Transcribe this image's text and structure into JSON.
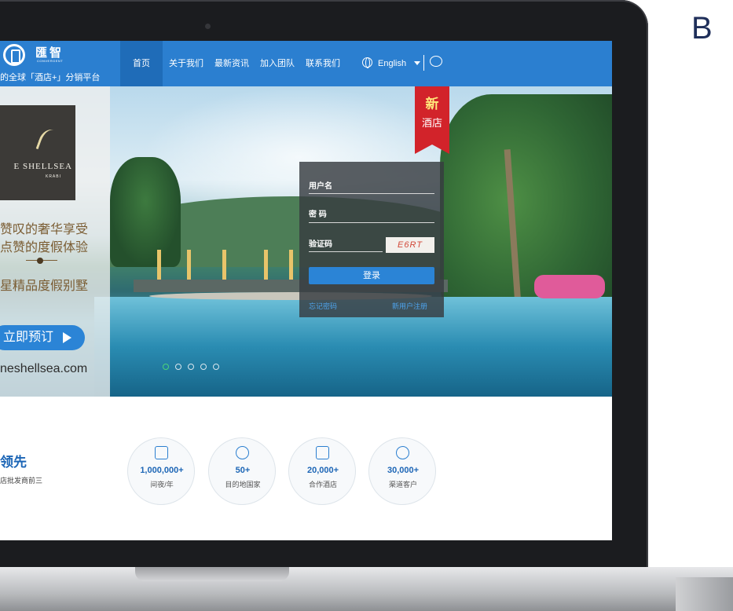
{
  "corner_text": "B",
  "logo": {
    "name": "匯智",
    "sub": "CONVERGENT",
    "slogan": "的全球「酒店+」分销平台"
  },
  "nav": {
    "items": [
      "首页",
      "关于我们",
      "最新资讯",
      "加入团队",
      "联系我们"
    ],
    "language": "English"
  },
  "promo": {
    "brand": "E SHELLSEA",
    "brand_sub": "KRABI",
    "line1": "赞叹的奢华享受",
    "line2": "点赞的度假体验",
    "line3": "星精品度假别墅",
    "book_button": "立即预订",
    "url": "neshellsea.com"
  },
  "ribbon": {
    "line1": "新",
    "line2": "酒店"
  },
  "login": {
    "username_label": "用户名",
    "password_label": "密 码",
    "captcha_label": "验证码",
    "captcha_text": "E6RT",
    "submit": "登录",
    "forgot": "忘记密码",
    "register": "新用户注册"
  },
  "slider": {
    "count": 5,
    "active_index": 0
  },
  "lead": {
    "title": "领先",
    "subtitle": "店批发商前三"
  },
  "stats": [
    {
      "value": "1,000,000+",
      "label": "间夜/年",
      "icon": "bed-icon"
    },
    {
      "value": "50+",
      "label": "目的地国家",
      "icon": "globe-icon"
    },
    {
      "value": "20,000+",
      "label": "合作酒店",
      "icon": "building-icon"
    },
    {
      "value": "30,000+",
      "label": "渠道客户",
      "icon": "users-icon"
    }
  ],
  "colors": {
    "nav_blue": "#2b7fd0",
    "accent_blue": "#1d66b6",
    "ribbon_red": "#d2232a",
    "promo_text": "#7a5c32"
  }
}
